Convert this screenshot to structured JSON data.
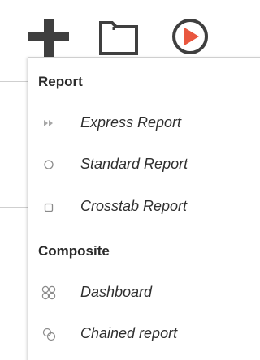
{
  "toolbar": {
    "add_icon": "plus-icon",
    "open_icon": "folder-icon",
    "run_icon": "play-circle-icon",
    "accent_color": "#e9573f",
    "icon_color": "#3f3f3f"
  },
  "menu": {
    "sections": [
      {
        "title": "Report",
        "items": [
          {
            "label": "Express Report",
            "icon": "fast-forward-icon"
          },
          {
            "label": "Standard Report",
            "icon": "circle-outline-icon"
          },
          {
            "label": "Crosstab Report",
            "icon": "square-outline-icon"
          }
        ]
      },
      {
        "title": "Composite",
        "items": [
          {
            "label": "Dashboard",
            "icon": "dashboard-grid-icon"
          },
          {
            "label": "Chained report",
            "icon": "chain-icon"
          }
        ]
      }
    ]
  }
}
